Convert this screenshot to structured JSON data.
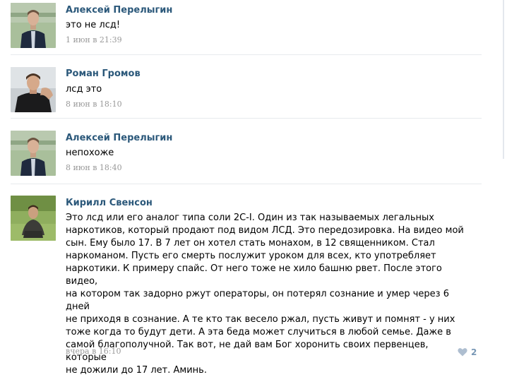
{
  "comments": [
    {
      "author": "Алексей Перелыгин",
      "text": "это не лсд!",
      "date": "1 июн в 21:39"
    },
    {
      "author": "Роман Громов",
      "text": "лсд это",
      "date": "8 июн в 18:10"
    },
    {
      "author": "Алексей Перелыгин",
      "text": "непохоже",
      "date": "8 июн в 18:40"
    },
    {
      "author": "Кирилл Свенсон",
      "lines": [
        "Это лсд или его аналог типа соли 2С-I. Один из так называемых легальных",
        "наркотиков, который продают под видом ЛСД. Это передозировка. На видео мой",
        "сын. Ему было 17. В 7 лет он хотел стать монахом, в 12 священником. Стал",
        "наркоманом. Пусть его смерть послужит уроком для всех, кто употребляет",
        "наркотики. К примеру спайс. От него тоже не хило башню рвет. После этого видео,",
        "на котором так задорно ржут операторы, он потерял сознание и умер через 6 дней",
        "не приходя в сознание. А те кто так весело ржал, пусть живут и помнят - у них",
        "тоже когда то будут дети. А эта беда может случиться в любой семье. Даже в",
        "самой благополучной. Так вот, не дай вам Бог хоронить своих первенцев, которые",
        "не дожили до 17 лет. Аминь."
      ],
      "date": "вчера в 16:10",
      "likes": "2"
    }
  ]
}
